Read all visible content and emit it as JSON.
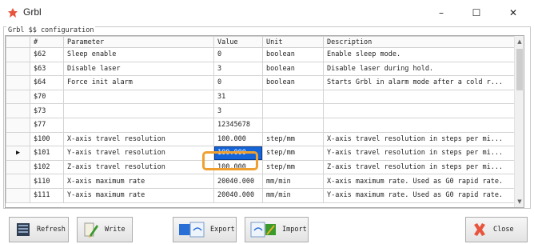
{
  "window": {
    "title": "Grbl",
    "min_glyph": "–",
    "max_glyph": "☐",
    "close_glyph": "✕"
  },
  "group": {
    "title": "Grbl $$ configuration"
  },
  "table": {
    "columns": [
      "#",
      "Parameter",
      "Value",
      "Unit",
      "Description"
    ],
    "rows": [
      {
        "id": "$62",
        "param": "Sleep enable",
        "value": "0",
        "unit": "boolean",
        "desc": "Enable sleep mode."
      },
      {
        "id": "$63",
        "param": "Disable laser",
        "value": "3",
        "unit": "boolean",
        "desc": "Disable laser during hold."
      },
      {
        "id": "$64",
        "param": "Force init alarm",
        "value": "0",
        "unit": "boolean",
        "desc": "Starts Grbl in alarm mode after a cold r..."
      },
      {
        "id": "$70",
        "param": "",
        "value": "31",
        "unit": "",
        "desc": ""
      },
      {
        "id": "$73",
        "param": "",
        "value": "3",
        "unit": "",
        "desc": ""
      },
      {
        "id": "$77",
        "param": "",
        "value": "12345678",
        "unit": "",
        "desc": ""
      },
      {
        "id": "$100",
        "param": "X-axis travel resolution",
        "value": "100.000",
        "unit": "step/mm",
        "desc": "X-axis travel resolution in steps per mi..."
      },
      {
        "id": "$101",
        "param": "Y-axis travel resolution",
        "value": "100.000",
        "unit": "step/mm",
        "desc": "Y-axis travel resolution in steps per mi..."
      },
      {
        "id": "$102",
        "param": "Z-axis travel resolution",
        "value": "100.000",
        "unit": "step/mm",
        "desc": "Z-axis travel resolution in steps per mi..."
      },
      {
        "id": "$110",
        "param": "X-axis maximum rate",
        "value": "20040.000",
        "unit": "mm/min",
        "desc": "X-axis maximum rate. Used as G0 rapid rate."
      },
      {
        "id": "$111",
        "param": "Y-axis maximum rate",
        "value": "20040.000",
        "unit": "mm/min",
        "desc": "Y-axis maximum rate. Used as G0 rapid rate."
      }
    ],
    "current_row_marker": "▶"
  },
  "scrollbar": {
    "up": "▲",
    "down": "▼"
  },
  "buttons": {
    "refresh": "Refresh",
    "write": "Write",
    "export": "Export",
    "import": "Import",
    "close": "Close"
  },
  "colors": {
    "selection": "#1565d8",
    "focus_ring": "#f0a030",
    "close_icon": "#e8543c"
  }
}
